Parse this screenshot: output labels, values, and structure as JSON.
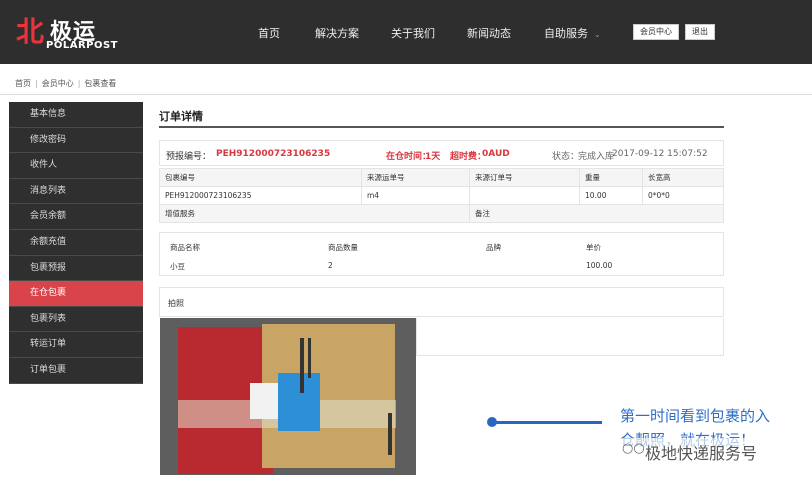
{
  "brand": {
    "logo_cn": "极运",
    "logo_mark": "北",
    "logo_en": "POLARPOST"
  },
  "nav": {
    "items": [
      {
        "label": "首页"
      },
      {
        "label": "解决方案"
      },
      {
        "label": "关于我们"
      },
      {
        "label": "新闻动态"
      },
      {
        "label": "自助服务"
      }
    ],
    "member_center": "会员中心",
    "logout": "退出"
  },
  "breadcrumb": [
    "首页",
    "会员中心",
    "包裹查看"
  ],
  "sidebar": {
    "items": [
      {
        "label": "基本信息"
      },
      {
        "label": "修改密码"
      },
      {
        "label": "收件人"
      },
      {
        "label": "消息列表"
      },
      {
        "label": "会员余额"
      },
      {
        "label": "余额充值"
      },
      {
        "label": "包裹预报"
      },
      {
        "label": "在仓包裹"
      },
      {
        "label": "包裹列表"
      },
      {
        "label": "转运订单"
      },
      {
        "label": "订单包裹"
      }
    ],
    "active_index": 7,
    "active_color": "#d9434a"
  },
  "order": {
    "title": "订单详情",
    "forecast_label": "预报编号：",
    "forecast_no": "PEH912000723106235",
    "in_stock_label": "在仓时间：",
    "in_stock_value": "1天",
    "overtime_label": "超时费：",
    "overtime_value": "0AUD",
    "status_label": "状态：",
    "status_value": "完成入库",
    "status_time": "2017-09-12 15:07:52",
    "table": {
      "headers": [
        "包裹编号",
        "来源运单号",
        "来源订单号",
        "重量",
        "长宽高"
      ],
      "values": [
        "PEH912000723106235",
        "m4",
        "",
        "10.00",
        "0*0*0"
      ],
      "svc_label": "增值服务",
      "remark_label": "备注"
    },
    "items": {
      "headers": [
        "商品名称",
        "商品数量",
        "品牌",
        "单价"
      ],
      "rows": [
        [
          "小豆",
          "2",
          "",
          "100.00"
        ]
      ]
    },
    "photo_label": "拍照"
  },
  "caption": {
    "line1": "第一时间看到包裹的入",
    "line2": "仓靓照，就在极运！"
  },
  "watermark": "极地快递服务号",
  "colors": {
    "accent_red": "#d9363e",
    "caption_blue": "#2e6ec7",
    "header_bg": "#2e2e2e"
  }
}
